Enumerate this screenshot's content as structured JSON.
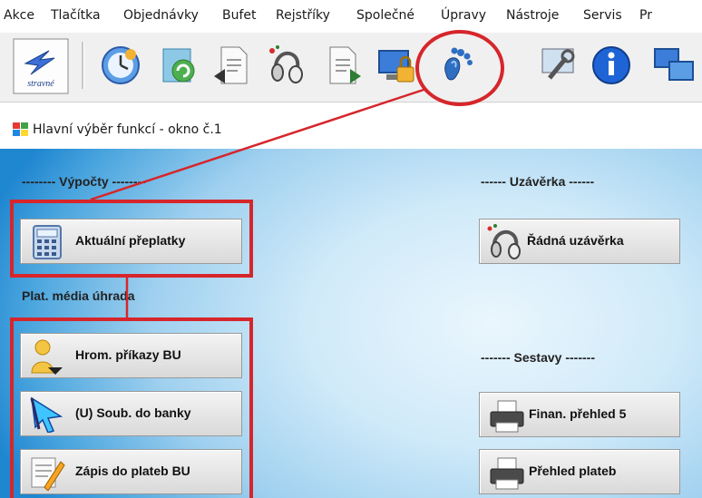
{
  "menu": [
    "Akce",
    "Tlačítka",
    "Objednávky",
    "Bufet",
    "Rejstříky",
    "Společné",
    "Úpravy",
    "Nástroje",
    "Servis",
    "Pr"
  ],
  "toolbar": {
    "logo_label": "stravné",
    "icons": [
      "stravne-logo-icon",
      "clock-icon",
      "recycle-icon",
      "document-arrow-icon",
      "headset-icon",
      "document-back-icon",
      "computer-lock-icon",
      "footprint-icon",
      "tools-icon",
      "info-icon",
      "network-icon"
    ]
  },
  "window": {
    "title": "Hlavní výběr funkcí - okno č.1",
    "sections": {
      "vypocty": "-------- Výpočty --------",
      "uzaverka": "------ Uzávěrka ------",
      "plat_media": "Plat. média úhrada",
      "sestavy": "------- Sestavy -------"
    },
    "buttons": {
      "aktualni_preplatky": "Aktuální přeplatky",
      "radna_uzaverka": "Řádná uzávěrka",
      "hrom_prikazy": "Hrom. příkazy BU",
      "soub_banky": "(U) Soub. do banky",
      "zapis_plateb": "Zápis do plateb BU",
      "finan_prehled": "Finan. přehled 5",
      "prehled_plateb": "Přehled plateb"
    }
  },
  "colors": {
    "highlight": "#d6262b",
    "window_gradient_edge": "#1f86d0"
  }
}
